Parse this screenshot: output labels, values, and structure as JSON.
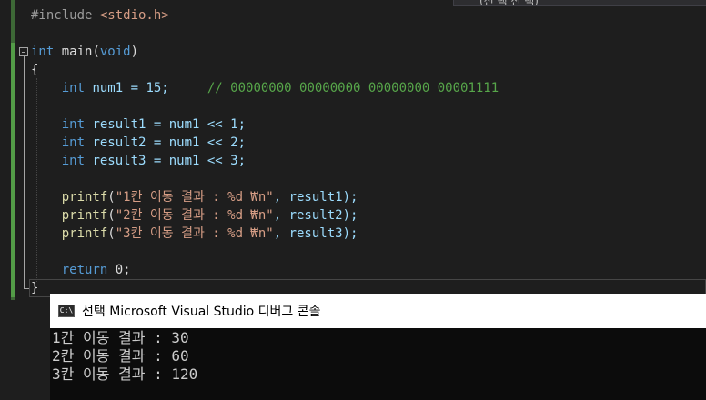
{
  "editor": {
    "top_tab_fragment": "(선 택 선 택)",
    "lines": [
      {
        "tokens": [
          {
            "t": "#include ",
            "c": "pp"
          },
          {
            "t": "<stdio.h>",
            "c": "str"
          }
        ]
      },
      {
        "tokens": []
      },
      {
        "tokens": [
          {
            "t": "int",
            "c": "kw"
          },
          {
            "t": " main(",
            "c": "plain"
          },
          {
            "t": "void",
            "c": "kw"
          },
          {
            "t": ")",
            "c": "plain"
          }
        ]
      },
      {
        "tokens": [
          {
            "t": "{",
            "c": "plain"
          }
        ]
      },
      {
        "tokens": [
          {
            "t": "    ",
            "c": "plain"
          },
          {
            "t": "int",
            "c": "kw"
          },
          {
            "t": " num1 = 15;     ",
            "c": "var"
          },
          {
            "t": "// 00000000 00000000 00000000 00001111",
            "c": "cm"
          }
        ]
      },
      {
        "tokens": []
      },
      {
        "tokens": [
          {
            "t": "    ",
            "c": "plain"
          },
          {
            "t": "int",
            "c": "kw"
          },
          {
            "t": " result1 = num1 << 1;",
            "c": "var"
          }
        ]
      },
      {
        "tokens": [
          {
            "t": "    ",
            "c": "plain"
          },
          {
            "t": "int",
            "c": "kw"
          },
          {
            "t": " result2 = num1 << 2;",
            "c": "var"
          }
        ]
      },
      {
        "tokens": [
          {
            "t": "    ",
            "c": "plain"
          },
          {
            "t": "int",
            "c": "kw"
          },
          {
            "t": " result3 = num1 << 3;",
            "c": "var"
          }
        ]
      },
      {
        "tokens": []
      },
      {
        "tokens": [
          {
            "t": "    ",
            "c": "plain"
          },
          {
            "t": "printf",
            "c": "fn"
          },
          {
            "t": "(",
            "c": "plain"
          },
          {
            "t": "\"1칸 이동 결과 : %d ₩n\"",
            "c": "str"
          },
          {
            "t": ", result1);",
            "c": "var"
          }
        ]
      },
      {
        "tokens": [
          {
            "t": "    ",
            "c": "plain"
          },
          {
            "t": "printf",
            "c": "fn"
          },
          {
            "t": "(",
            "c": "plain"
          },
          {
            "t": "\"2칸 이동 결과 : %d ₩n\"",
            "c": "str"
          },
          {
            "t": ", result2);",
            "c": "var"
          }
        ]
      },
      {
        "tokens": [
          {
            "t": "    ",
            "c": "plain"
          },
          {
            "t": "printf",
            "c": "fn"
          },
          {
            "t": "(",
            "c": "plain"
          },
          {
            "t": "\"3칸 이동 결과 : %d ₩n\"",
            "c": "str"
          },
          {
            "t": ", result3);",
            "c": "var"
          }
        ]
      },
      {
        "tokens": []
      },
      {
        "tokens": [
          {
            "t": "    ",
            "c": "plain"
          },
          {
            "t": "return",
            "c": "kw"
          },
          {
            "t": " 0;",
            "c": "plain"
          }
        ]
      },
      {
        "tokens": [
          {
            "t": "}",
            "c": "plain"
          }
        ]
      }
    ]
  },
  "console": {
    "icon_text": "C:\\",
    "title": "선택 Microsoft Visual Studio 디버그 콘솔",
    "output": [
      "1칸 이동 결과 : 30",
      "2칸 이동 결과 : 60",
      "3칸 이동 결과 : 120"
    ]
  },
  "colors": {
    "background": "#1e1e1e",
    "keyword": "#569cd6",
    "string": "#d69d85",
    "comment": "#57a64a",
    "console_bg": "#0c0c0c"
  }
}
